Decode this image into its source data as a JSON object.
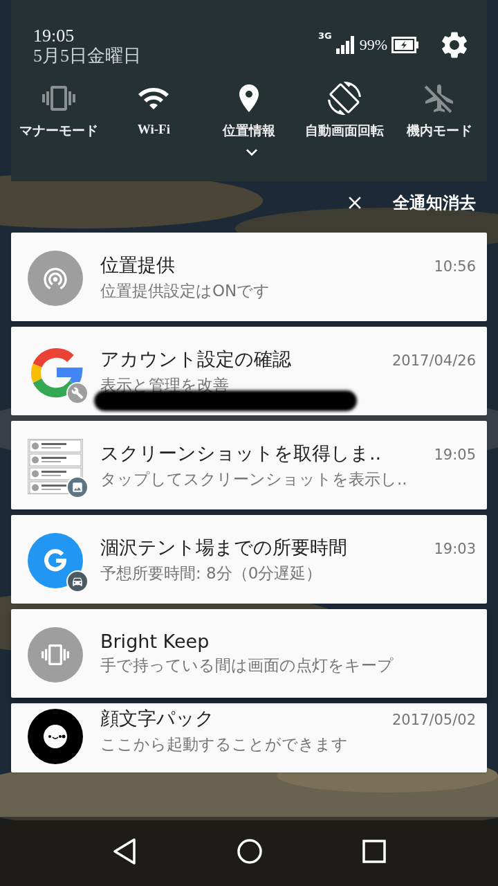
{
  "status": {
    "time": "19:05",
    "date": "5月5日金曜日",
    "network": "3G",
    "battery": "99%"
  },
  "quick_settings": [
    {
      "kind": "manner",
      "label": "マナーモード",
      "on": false
    },
    {
      "kind": "wifi",
      "label": "Wi-Fi",
      "on": true
    },
    {
      "kind": "location",
      "label": "位置情報",
      "on": true
    },
    {
      "kind": "rotation",
      "label": "自動画面回転",
      "on": true
    },
    {
      "kind": "airplane",
      "label": "機内モード",
      "on": false
    }
  ],
  "clear_all": {
    "label": "全通知消去"
  },
  "notifications": [
    {
      "kind": "location",
      "title": "位置提供",
      "text": "位置提供設定はONです",
      "time": "10:56"
    },
    {
      "kind": "google",
      "title": "アカウント設定の確認",
      "text": "表示と管理を改善",
      "time": "2017/04/26",
      "redacted": true
    },
    {
      "kind": "screenshot",
      "title": "スクリーンショットを取得しま..",
      "text": "タップしてスクリーンショットを表示し..",
      "time": "19:05"
    },
    {
      "kind": "maps",
      "title": "涸沢テント場までの所要時間",
      "text": "予想所要時間: 8分（0分遅延）",
      "time": "19:03"
    },
    {
      "kind": "bright",
      "title": "Bright Keep",
      "text": "手で持っている間は画面の点灯をキープ"
    },
    {
      "kind": "kaomoji",
      "title": "顔文字パック",
      "text": "ここから起動することができます",
      "time": "2017/05/02"
    }
  ]
}
